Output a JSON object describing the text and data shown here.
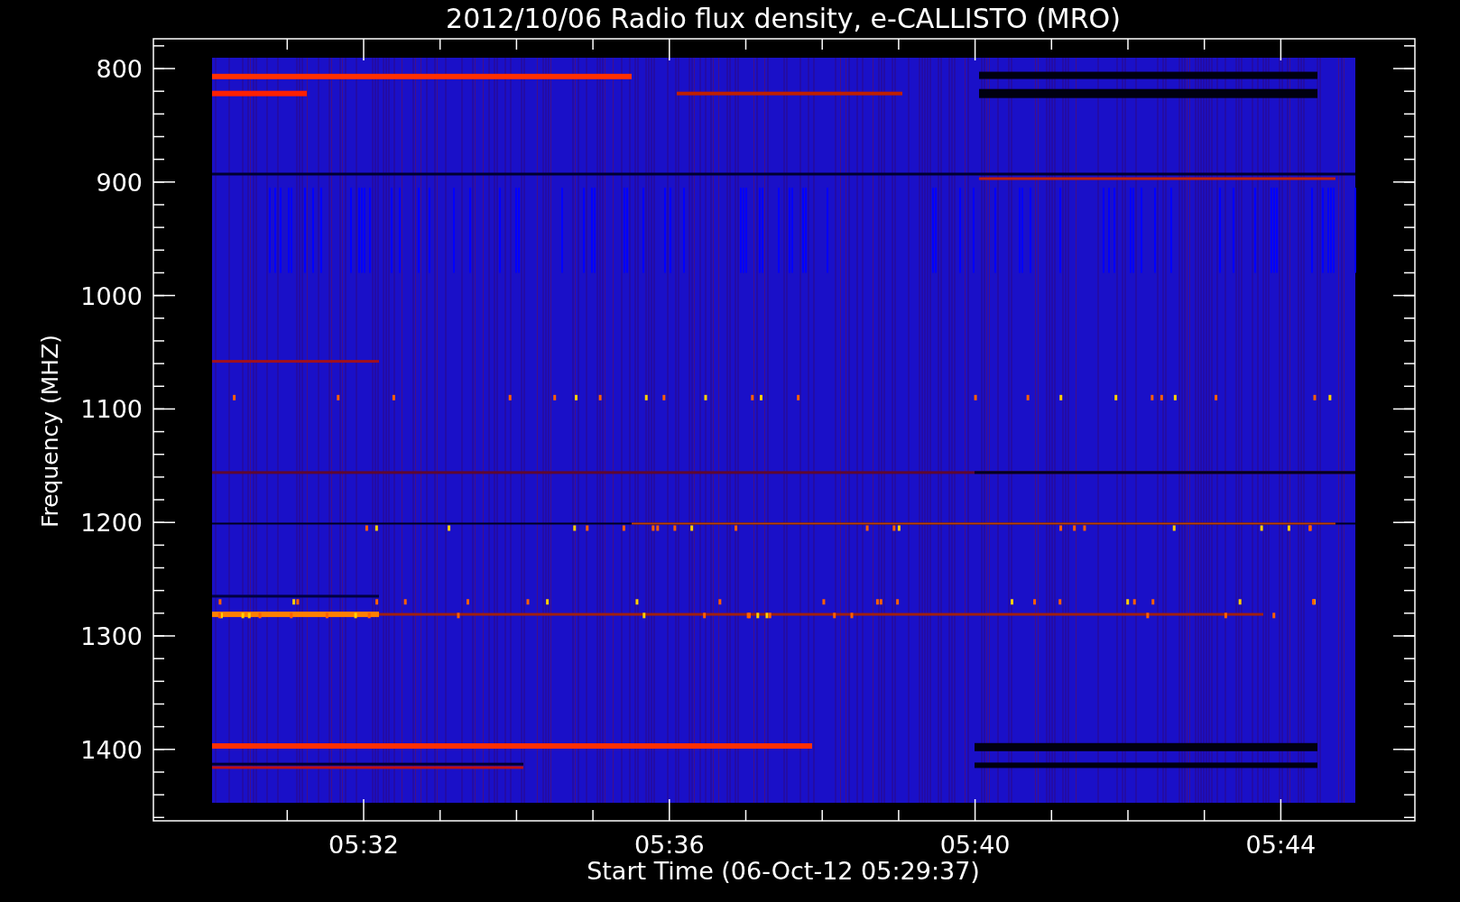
{
  "title": "2012/10/06  Radio flux density, e-CALLISTO (MRO)",
  "y_axis": {
    "label": "Frequency (MHZ)",
    "ticks": [
      "800",
      "900",
      "1000",
      "1100",
      "1200",
      "1300",
      "1400"
    ]
  },
  "x_axis": {
    "label": "Start Time (06-Oct-12 05:29:37)",
    "ticks": [
      "05:32",
      "05:36",
      "05:40",
      "05:44"
    ]
  }
}
